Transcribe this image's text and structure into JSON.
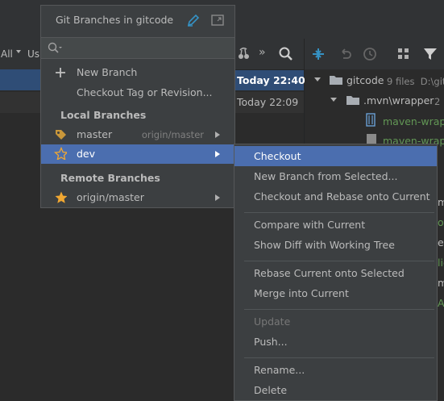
{
  "background": {
    "toolbar_left": [
      "All",
      "Us"
    ],
    "log_rows": [
      {
        "date": "Today 22:40",
        "selected": true
      },
      {
        "date": "Today 22:09",
        "selected": false
      }
    ],
    "tree": {
      "root": "gitcode",
      "root_meta": "9 files  D:\\git",
      "folder": ".mvn\\wrapper",
      "folder_count": "2",
      "files": [
        "maven-wrapp",
        "maven-wrapp"
      ]
    },
    "right_edge_letters": [
      "m",
      "o",
      "es",
      "lic",
      "m",
      "A"
    ]
  },
  "popup": {
    "title": "Git Branches in gitcode",
    "search_placeholder": "",
    "actions": [
      {
        "label": "New Branch",
        "icon": "plus-icon"
      },
      {
        "label": "Checkout Tag or Revision...",
        "icon": ""
      }
    ],
    "local_header": "Local Branches",
    "local": [
      {
        "name": "master",
        "tracking": "origin/master",
        "icon": "tag-icon"
      },
      {
        "name": "dev",
        "tracking": "",
        "icon": "star-outline-icon",
        "selected": true
      }
    ],
    "remote_header": "Remote Branches",
    "remote": [
      {
        "name": "origin/master",
        "icon": "star-filled-icon"
      }
    ]
  },
  "submenu": {
    "items": [
      {
        "label": "Checkout",
        "selected": true
      },
      {
        "label": "New Branch from Selected..."
      },
      {
        "label": "Checkout and Rebase onto Current"
      },
      {
        "label": "Compare with Current"
      },
      {
        "label": "Show Diff with Working Tree"
      },
      {
        "label": "Rebase Current onto Selected"
      },
      {
        "label": "Merge into Current"
      },
      {
        "label": "Update",
        "disabled": true
      },
      {
        "label": "Push..."
      },
      {
        "label": "Rename..."
      },
      {
        "label": "Delete"
      }
    ]
  },
  "colors": {
    "selection": "#4b6eaf",
    "popup_bg": "#3c3f41",
    "star": "#f0a732",
    "file_green": "#629755",
    "branch_blue": "#3592c4"
  }
}
